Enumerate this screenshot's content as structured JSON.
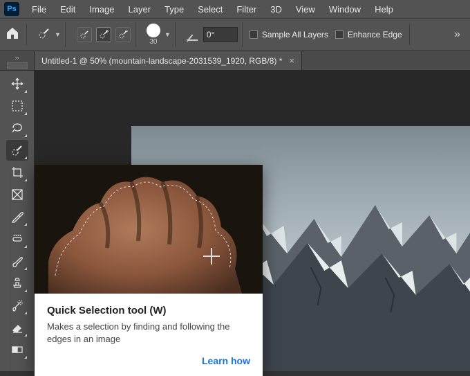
{
  "menubar": [
    "File",
    "Edit",
    "Image",
    "Layer",
    "Type",
    "Select",
    "Filter",
    "3D",
    "View",
    "Window",
    "Help"
  ],
  "options": {
    "brush_size": "30",
    "angle": "0°",
    "sample_all_layers": "Sample All Layers",
    "enhance_edge": "Enhance Edge"
  },
  "tab": {
    "label": "Untitled-1 @ 50% (mountain-landscape-2031539_1920, RGB/8) *"
  },
  "tools": [
    {
      "name": "move-tool"
    },
    {
      "name": "marquee-tool"
    },
    {
      "name": "lasso-tool"
    },
    {
      "name": "quick-select-tool",
      "active": true
    },
    {
      "name": "crop-tool"
    },
    {
      "name": "frame-tool"
    },
    {
      "name": "eyedropper-tool"
    },
    {
      "name": "healing-brush-tool"
    },
    {
      "name": "brush-tool"
    },
    {
      "name": "clone-stamp-tool"
    },
    {
      "name": "history-brush-tool"
    },
    {
      "name": "eraser-tool"
    },
    {
      "name": "gradient-tool"
    }
  ],
  "tooltip": {
    "title": "Quick Selection tool (W)",
    "desc": "Makes a selection by finding and following the edges in an image",
    "link": "Learn how"
  }
}
